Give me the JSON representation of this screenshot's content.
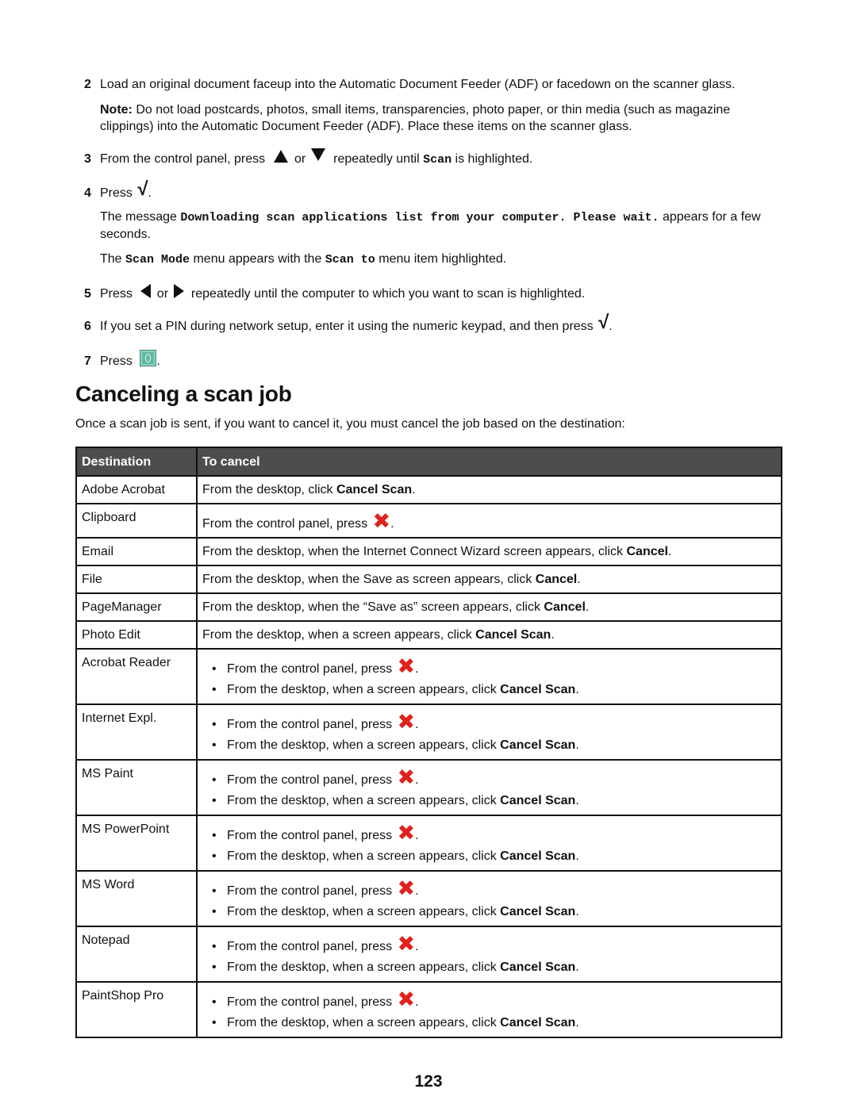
{
  "steps": {
    "s2": {
      "num": "2",
      "text": "Load an original document faceup into the Automatic Document Feeder (ADF) or facedown on the scanner glass."
    },
    "note": {
      "label": "Note:",
      "text": " Do not load postcards, photos, small items, transparencies, photo paper, or thin media (such as magazine clippings) into the Automatic Document Feeder (ADF). Place these items on the scanner glass."
    },
    "s3": {
      "num": "3",
      "pre": "From the control panel, press ",
      "mid": " or ",
      "post": " repeatedly until ",
      "code": "Scan",
      "end": " is highlighted."
    },
    "s4": {
      "num": "4",
      "pre": "Press ",
      "end": "."
    },
    "s4_msg": {
      "pre": "The message ",
      "code": "Downloading scan applications list from your computer. Please wait.",
      "post": " appears for a few seconds."
    },
    "s4_menu": {
      "pre": "The ",
      "code1": "Scan Mode",
      "mid": " menu appears with the ",
      "code2": "Scan to",
      "post": " menu item highlighted."
    },
    "s5": {
      "num": "5",
      "pre": "Press ",
      "mid": " or ",
      "post": " repeatedly until the computer to which you want to scan is highlighted."
    },
    "s6": {
      "num": "6",
      "text": "If you set a PIN during network setup, enter it using the numeric keypad, and then press ",
      "end": "."
    },
    "s7": {
      "num": "7",
      "pre": "Press ",
      "end": "."
    }
  },
  "icons": {
    "up": "up-arrow-button",
    "down": "down-arrow-button",
    "left": "left-arrow-button",
    "right": "right-arrow-button",
    "check": "√",
    "start": "start-button",
    "cancel": "✖"
  },
  "section": {
    "title": "Canceling a scan job",
    "intro": "Once a scan job is sent, if you want to cancel it, you must cancel the job based on the destination:"
  },
  "table": {
    "headers": [
      "Destination",
      "To cancel"
    ],
    "header_bg": "#4d4d4d",
    "rows": [
      {
        "dest": "Adobe Acrobat",
        "pre": "From the desktop, click ",
        "bold": "Cancel Scan",
        "post": "."
      },
      {
        "dest": "Clipboard",
        "pre": "From the control panel, press ",
        "post": "."
      },
      {
        "dest": "Email",
        "pre": "From the desktop, when the Internet Connect Wizard screen appears, click ",
        "bold": "Cancel",
        "post": "."
      },
      {
        "dest": "File",
        "pre": "From the desktop, when the Save as screen appears, click ",
        "bold": "Cancel",
        "post": "."
      },
      {
        "dest": "PageManager",
        "pre": "From the desktop, when the “Save as” screen appears, click ",
        "bold": "Cancel",
        "post": "."
      },
      {
        "dest": "Photo Edit",
        "pre": "From the desktop, when a screen appears, click ",
        "bold": "Cancel Scan",
        "post": "."
      }
    ],
    "bullet_rows": [
      {
        "dest": "Acrobat Reader"
      },
      {
        "dest": "Internet Expl."
      },
      {
        "dest": "MS Paint"
      },
      {
        "dest": "MS PowerPoint"
      },
      {
        "dest": "MS Word"
      },
      {
        "dest": "Notepad"
      },
      {
        "dest": "PaintShop Pro"
      }
    ],
    "bullet_text": {
      "b1_pre": "From the control panel, press ",
      "b1_post": ".",
      "b2_pre": "From the desktop, when a screen appears, click ",
      "b2_bold": "Cancel Scan",
      "b2_post": "."
    }
  },
  "page_number": "123",
  "colors": {
    "cancel_red": "#e0221e",
    "start_teal": "#5fb8a4"
  }
}
